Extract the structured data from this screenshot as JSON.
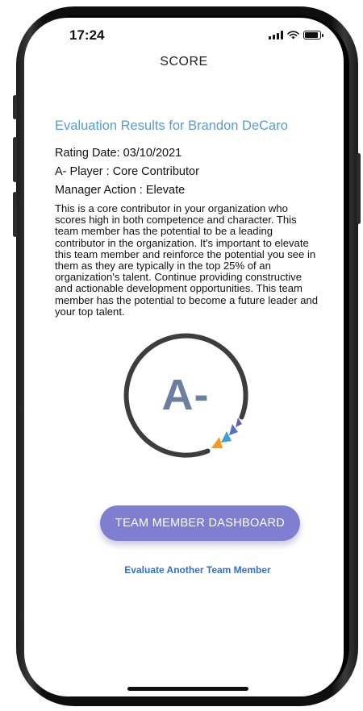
{
  "status_bar": {
    "time": "17:24"
  },
  "nav": {
    "title": "SCORE"
  },
  "evaluation": {
    "title": "Evaluation Results for Brandon DeCaro",
    "rating_date": "Rating Date: 03/10/2021",
    "player": "A- Player : Core Contributor",
    "manager_action": "Manager Action : Elevate",
    "description": "This is a core contributor in your organization who scores high in both competence and character. This team member has the potential to be a leading contributor in the organization. It's important to elevate this team member and reinforce the potential you see in them as they are typically in the top 25% of an organization's talent. Continue providing constructive and actionable development opportunities. This team member has the potential to become a future leader and your top talent."
  },
  "grade": {
    "letter": "A-"
  },
  "actions": {
    "dashboard_button": "TEAM MEMBER DASHBOARD",
    "evaluate_link": "Evaluate Another Team Member"
  },
  "colors": {
    "accent_title": "#5a9bd3",
    "button": "#7f7fd1",
    "grade_text": "#6c7fa1",
    "ring": "#3d3d3d",
    "marker_orange": "#f39a1f",
    "marker_blue": "#3f9ed3",
    "marker_indigo": "#5b6fc7",
    "marker_purple": "#6d5bb0"
  }
}
